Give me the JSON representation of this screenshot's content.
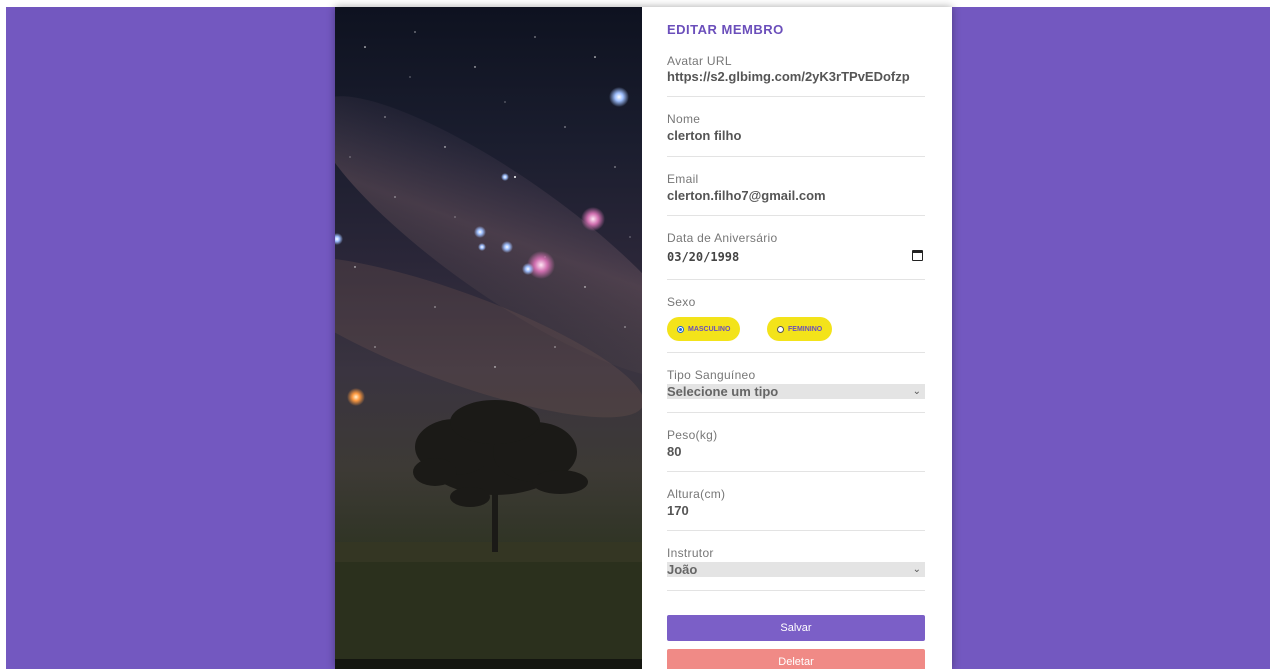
{
  "form": {
    "title": "EDITAR MEMBRO",
    "avatar": {
      "label": "Avatar URL",
      "value": "https://s2.glbimg.com/2yK3rTPvEDofzp"
    },
    "name": {
      "label": "Nome",
      "value": "clerton filho"
    },
    "email": {
      "label": "Email",
      "value": "clerton.filho7@gmail.com"
    },
    "birthday": {
      "label": "Data de Aniversário",
      "value": "03/20/1998",
      "icon": "calendar-icon"
    },
    "sex": {
      "label": "Sexo",
      "options": [
        {
          "label": "MASCULINO",
          "checked": true
        },
        {
          "label": "FEMININO",
          "checked": false
        }
      ]
    },
    "blood_type": {
      "label": "Tipo Sanguíneo",
      "selected": "Selecione um tipo",
      "icon": "chevron-down-icon"
    },
    "weight": {
      "label": "Peso(kg)",
      "value": "80"
    },
    "height": {
      "label": "Altura(cm)",
      "value": "170"
    },
    "instructor": {
      "label": "Instrutor",
      "selected": "João",
      "icon": "chevron-down-icon"
    },
    "save_label": "Salvar",
    "delete_label": "Deletar"
  },
  "colors": {
    "background": "#7358c0",
    "title": "#6b4fbb",
    "radio_pill": "#f3e31a",
    "save_button": "#7b5fc7",
    "delete_button": "#f08a86"
  }
}
